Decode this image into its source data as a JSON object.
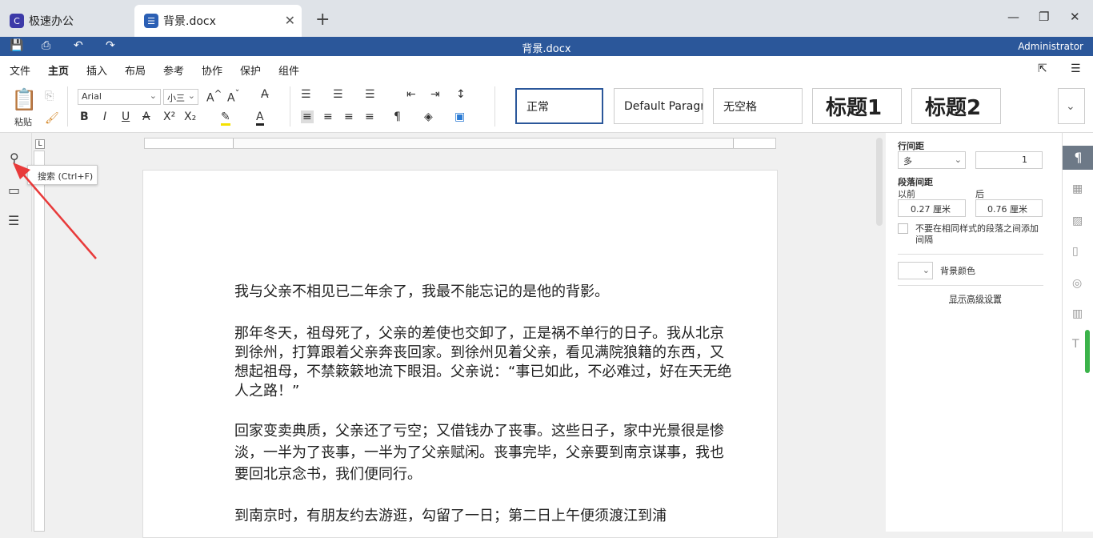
{
  "tabs": [
    {
      "label": "极速办公"
    },
    {
      "label": "背景.docx"
    }
  ],
  "titlebar": {
    "title": "背景.docx",
    "user": "Administrator"
  },
  "menu": [
    "文件",
    "主页",
    "插入",
    "布局",
    "参考",
    "协作",
    "保护",
    "组件"
  ],
  "ribbon": {
    "paste_label": "粘贴",
    "font_name": "Arial",
    "font_size": "小三"
  },
  "styles": [
    "正常",
    "Default Paragr",
    "无空格",
    "标题1",
    "标题2"
  ],
  "tooltip": "搜索 (Ctrl+F)",
  "document": {
    "paragraphs": [
      "我与父亲不相见已二年余了，我最不能忘记的是他的背影。",
      "那年冬天，祖母死了，父亲的差使也交卸了，正是祸不单行的日子。我从北京到徐州，打算跟着父亲奔丧回家。到徐州见着父亲，看见满院狼籍的东西，又想起祖母，不禁簌簌地流下眼泪。父亲说：“事已如此，不必难过，好在天无绝人之路！”",
      "回家变卖典质，父亲还了亏空；又借钱办了丧事。这些日子，家中光景很是惨淡，一半为了丧事，一半为了父亲赋闲。丧事完毕，父亲要到南京谋事，我也要回北京念书，我们便同行。",
      "到南京时，有朋友约去游逛，勾留了一日；第二日上午便须渡江到浦"
    ]
  },
  "panel": {
    "line_spacing_label": "行间距",
    "line_spacing_type": "多",
    "line_spacing_value": "1",
    "para_spacing_label": "段落间距",
    "before_label": "以前",
    "after_label": "后",
    "before_value": "0.27 厘米",
    "after_value": "0.76 厘米",
    "checkbox_label": "不要在相同样式的段落之间添加间隔",
    "bg_color_label": "背景颜色",
    "advanced_link": "显示高级设置"
  },
  "colors": {
    "accent": "#2b579a",
    "arrow": "#e83a3a"
  }
}
